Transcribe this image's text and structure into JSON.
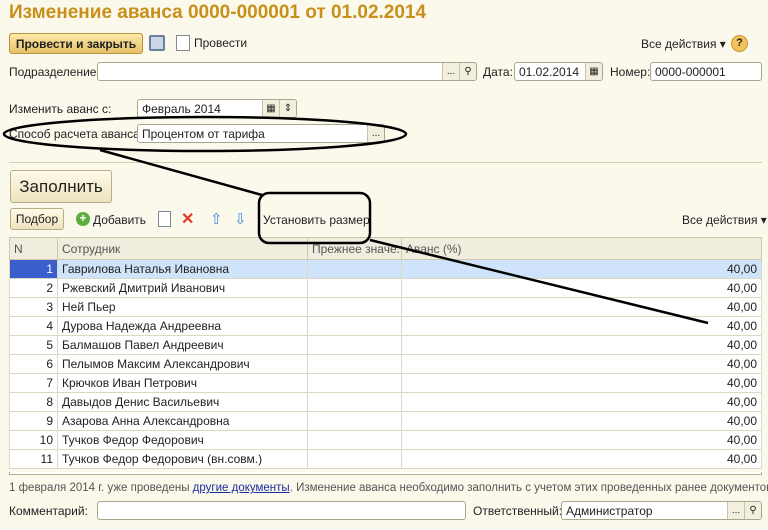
{
  "title": "Изменение аванса 0000-000001 от 01.02.2014",
  "toolbar": {
    "post_close": "Провести и закрыть",
    "post": "Провести",
    "all_actions": "Все действия ▾",
    "help": "?"
  },
  "form": {
    "division_label": "Подразделение:",
    "division_value": "",
    "date_label": "Дата:",
    "date_value": "01.02.2014",
    "number_label": "Номер:",
    "number_value": "0000-000001",
    "change_from_label": "Изменить аванс с:",
    "change_from_value": "Февраль 2014",
    "method_label": "Способ расчета аванса:",
    "method_value": "Процентом от тарифа"
  },
  "fill_button": "Заполнить",
  "table_toolbar": {
    "pick": "Подбор",
    "add": "Добавить",
    "set_size": "Установить размер",
    "all_actions": "Все действия ▾"
  },
  "table": {
    "columns": [
      "N",
      "Сотрудник",
      "Прежнее значе...",
      "Аванс (%)"
    ],
    "rows": [
      {
        "n": "1",
        "name": "Гаврилова Наталья Ивановна",
        "prev": "",
        "value": "40,00"
      },
      {
        "n": "2",
        "name": "Ржевский Дмитрий Иванович",
        "prev": "",
        "value": "40,00"
      },
      {
        "n": "3",
        "name": "Ней Пьер",
        "prev": "",
        "value": "40,00"
      },
      {
        "n": "4",
        "name": "Дурова Надежда Андреевна",
        "prev": "",
        "value": "40,00"
      },
      {
        "n": "5",
        "name": "Балмашов Павел Андреевич",
        "prev": "",
        "value": "40,00"
      },
      {
        "n": "6",
        "name": "Пелымов Максим Александрович",
        "prev": "",
        "value": "40,00"
      },
      {
        "n": "7",
        "name": "Крючков Иван Петрович",
        "prev": "",
        "value": "40,00"
      },
      {
        "n": "8",
        "name": "Давыдов Денис Васильевич",
        "prev": "",
        "value": "40,00"
      },
      {
        "n": "9",
        "name": "Азарова Анна Александровна",
        "prev": "",
        "value": "40,00"
      },
      {
        "n": "10",
        "name": "Тучков Федор Федорович",
        "prev": "",
        "value": "40,00"
      },
      {
        "n": "11",
        "name": "Тучков Федор Федорович (вн.совм.)",
        "prev": "",
        "value": "40,00"
      }
    ]
  },
  "notice": {
    "pre": "1 февраля 2014 г. уже проведены ",
    "link": "другие документы",
    "post": ". Изменение аванса необходимо заполнить с учетом этих проведенных ранее документов."
  },
  "footer": {
    "comment_label": "Комментарий:",
    "comment_value": "",
    "responsible_label": "Ответственный:",
    "responsible_value": "Администратор"
  }
}
